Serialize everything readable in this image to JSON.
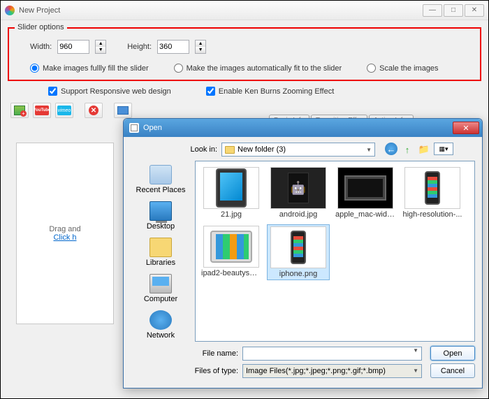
{
  "window": {
    "title": "New Project",
    "min": "—",
    "max": "□",
    "close": "✕"
  },
  "slider": {
    "group_title": "Slider options",
    "width_label": "Width:",
    "width_value": "960",
    "height_label": "Height:",
    "height_value": "360",
    "radio1": "Make images fullly fill the slider",
    "radio2": "Make the images automatically fit to the slider",
    "radio3": "Scale the images"
  },
  "checks": {
    "responsive": "Support Responsive web design",
    "kenburns": "Enable Ken Burns Zooming Effect"
  },
  "toolbar": {
    "youtube": "YouTube",
    "vimeo": "vimeo"
  },
  "tabs": {
    "t1": "Basic Info",
    "t2": "Transition Eff...",
    "t3": "Action Inf..."
  },
  "drop": {
    "line1": "Drag and",
    "link": "Click h"
  },
  "open": {
    "title": "Open",
    "lookin_label": "Look in:",
    "lookin_value": "New folder (3)",
    "places": {
      "recent": "Recent Places",
      "desktop": "Desktop",
      "libraries": "Libraries",
      "computer": "Computer",
      "network": "Network"
    },
    "files": {
      "f1": "21.jpg",
      "f2": "android.jpg",
      "f3": "apple_mac-wide...",
      "f4": "high-resolution-...",
      "f5": "ipad2-beautysho...",
      "f6": "iphone.png"
    },
    "filename_label": "File name:",
    "filename_value": "",
    "filetype_label": "Files of type:",
    "filetype_value": "Image Files(*.jpg;*.jpeg;*.png;*.gif;*.bmp)",
    "open_btn": "Open",
    "cancel_btn": "Cancel"
  }
}
